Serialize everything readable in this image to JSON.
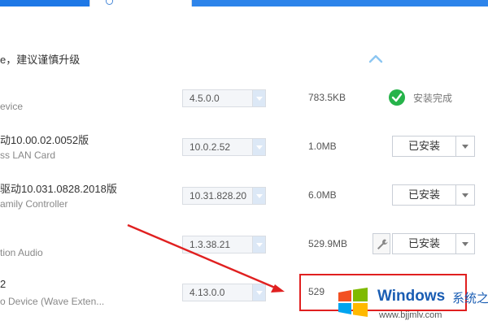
{
  "section": {
    "title": "e，建议谨慎升级"
  },
  "drivers": [
    {
      "name": "",
      "desc": "evice",
      "version": "4.5.0.0",
      "size": "783.5KB",
      "status": "安装完成"
    },
    {
      "name": "动10.00.02.0052版",
      "desc": "ss LAN Card",
      "version": "10.0.2.52",
      "size": "1.0MB",
      "button": "已安装"
    },
    {
      "name": "驱动10.031.0828.2018版",
      "desc": "amily Controller",
      "version": "10.31.828.20",
      "size": "6.0MB",
      "button": "已安装"
    },
    {
      "name": "",
      "desc": "tion Audio",
      "version": "1.3.38.21",
      "size": "529.9MB",
      "button": "已安装"
    },
    {
      "name": "2",
      "desc": "o Device (Wave Exten...",
      "version": "4.13.0.0",
      "size": "529"
    }
  ],
  "icons": {
    "collapse": "chevron-up-icon",
    "installed": "check-circle-icon",
    "repair": "wrench-icon",
    "dropdown": "chevron-down-icon"
  },
  "watermark": {
    "title": "Windows",
    "cn": "系统之家",
    "url": "www.bjjmlv.com"
  },
  "colors": {
    "accent": "#1e78e6",
    "success": "#26b34a",
    "annotation": "#e02020"
  }
}
